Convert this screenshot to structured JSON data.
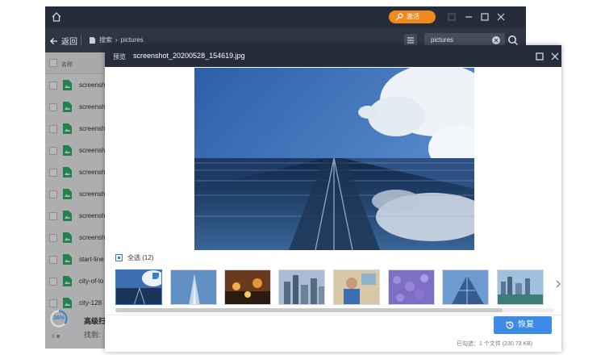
{
  "app": {
    "upgrade_label": "激活",
    "back_label": "返回",
    "breadcrumb_root": "搜索",
    "breadcrumb_current": "pictures",
    "search_value": "pictures",
    "column_name": "名称",
    "files": [
      "screensh",
      "screensh",
      "screensh",
      "screensh",
      "screensh",
      "screensh",
      "screensh",
      "screensh",
      "start-line",
      "city-of-lo",
      "city-128"
    ],
    "scan_progress": "36%",
    "scan_title": "高级扫",
    "scan_found": "找到:",
    "scan_controls": "II ■"
  },
  "dialog": {
    "label": "预览",
    "filename": "screenshot_20200528_154619.jpg",
    "select_all_label": "全选 (12)",
    "restore_label": "恢复",
    "status": "已勾选：1 个文件 (230.73 KB)"
  },
  "colors": {
    "titlebar": "#262c3a",
    "accent": "#3c8ae4",
    "upgrade": "#f08a1c",
    "file_icon": "#2fb568"
  }
}
